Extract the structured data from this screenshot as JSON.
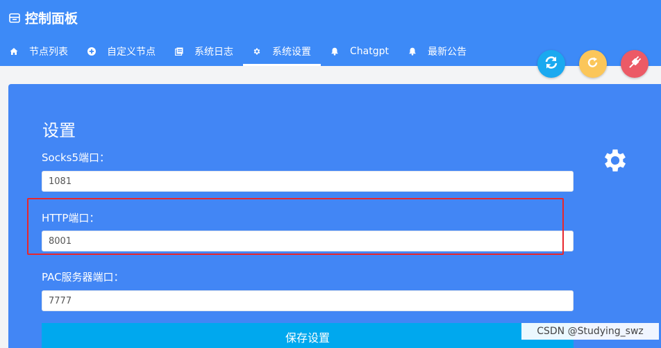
{
  "app": {
    "title": "控制面板"
  },
  "tabs": [
    {
      "label": "节点列表",
      "icon": "home-icon"
    },
    {
      "label": "自定义节点",
      "icon": "plus-circle-icon"
    },
    {
      "label": "系统日志",
      "icon": "log-icon"
    },
    {
      "label": "系统设置",
      "icon": "gear-icon",
      "active": true
    },
    {
      "label": "Chatgpt",
      "icon": "bell-icon"
    },
    {
      "label": "最新公告",
      "icon": "bell-icon"
    }
  ],
  "actions": {
    "sync": {
      "icon": "sync-icon",
      "color": "#1aa9f0"
    },
    "refresh": {
      "icon": "refresh-icon",
      "color": "#fbc65a"
    },
    "disconnect": {
      "icon": "plug-icon",
      "color": "#ec5a66"
    }
  },
  "settings": {
    "title": "设置",
    "socks5": {
      "label": "Socks5端口：",
      "value": "1081"
    },
    "http": {
      "label": "HTTP端口：",
      "value": "8001"
    },
    "pac": {
      "label": "PAC服务器端口：",
      "value": "7777"
    },
    "save_label": "保存设置"
  },
  "watermark": "CSDN @Studying_swz",
  "colors": {
    "header": "#3d8af7",
    "card": "#4286f5",
    "save_button": "#00a8ee",
    "highlight": "#e8262b"
  }
}
